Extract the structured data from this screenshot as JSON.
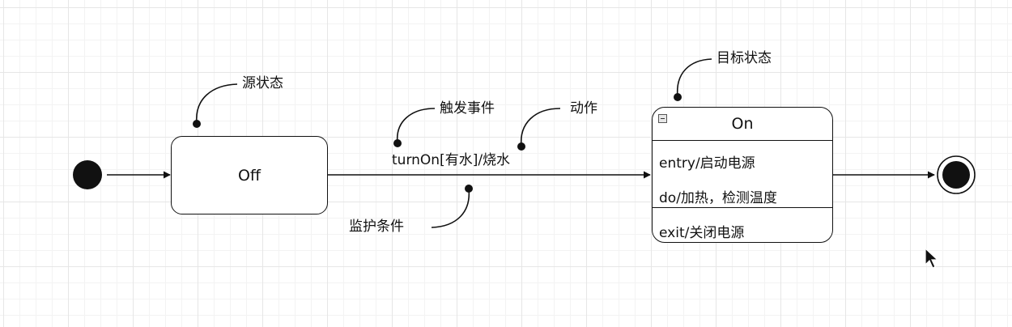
{
  "diagram": {
    "states": {
      "off": {
        "name": "Off"
      },
      "on": {
        "name": "On",
        "activities": {
          "entry": "entry/启动电源",
          "do": "do/加热，检测温度",
          "exit": "exit/关闭电源"
        }
      }
    },
    "transition": {
      "label": "turnOn[有水]/烧水"
    },
    "annotations": {
      "source_state": "源状态",
      "trigger_event": "触发事件",
      "action": "动作",
      "target_state": "目标状态",
      "guard_condition": "监护条件"
    },
    "colors": {
      "stroke": "#111111",
      "grid": "#e6e6e6",
      "background": "#ffffff"
    }
  }
}
